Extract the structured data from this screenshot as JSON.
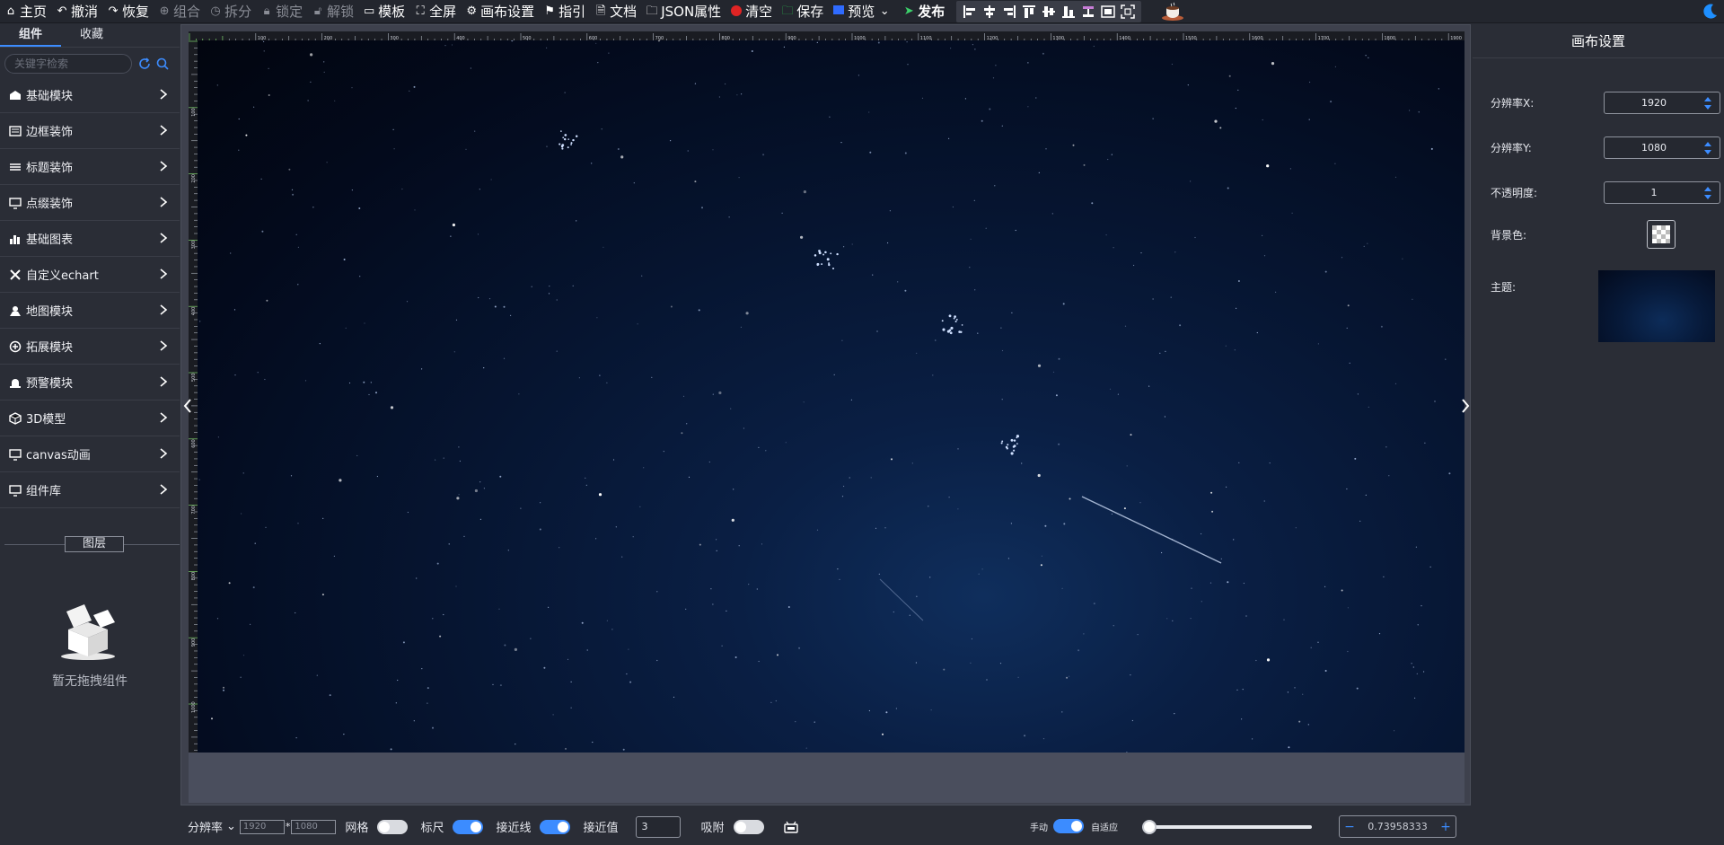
{
  "toolbar": {
    "items": [
      {
        "label": "主页",
        "icon": "home-icon",
        "dim": false
      },
      {
        "label": "撤消",
        "icon": "undo-icon",
        "dim": false
      },
      {
        "label": "恢复",
        "icon": "redo-icon",
        "dim": false
      },
      {
        "label": "组合",
        "icon": "group-icon",
        "dim": true
      },
      {
        "label": "拆分",
        "icon": "split-icon",
        "dim": true
      },
      {
        "label": "锁定",
        "icon": "lock-icon",
        "dim": true
      },
      {
        "label": "解锁",
        "icon": "unlock-icon",
        "dim": true
      },
      {
        "label": "模板",
        "icon": "template-icon",
        "dim": false
      },
      {
        "label": "全屏",
        "icon": "fullscreen-icon",
        "dim": false
      },
      {
        "label": "画布设置",
        "icon": "gear-icon",
        "dim": false
      },
      {
        "label": "指引",
        "icon": "flag-icon",
        "dim": false
      },
      {
        "label": "文档",
        "icon": "document-icon",
        "dim": false
      },
      {
        "label": "JSON属性",
        "icon": "folder-icon",
        "dim": false
      },
      {
        "label": "清空",
        "icon": "clear-icon",
        "dim": false
      },
      {
        "label": "保存",
        "icon": "save-icon",
        "dim": false
      },
      {
        "label": "预览",
        "icon": "preview-icon",
        "dim": false
      },
      {
        "label": "发布",
        "icon": "publish-icon",
        "dim": false
      }
    ],
    "colors": {
      "clear": "#e02424",
      "save": "#2bb24c",
      "preview": "#2f6bff",
      "publish": "#3cd16b"
    }
  },
  "sidebar": {
    "tabs": [
      "组件",
      "收藏"
    ],
    "search_placeholder": "关键字检索",
    "items": [
      {
        "label": "基础模块",
        "icon": "building-icon"
      },
      {
        "label": "边框装饰",
        "icon": "border-icon"
      },
      {
        "label": "标题装饰",
        "icon": "title-icon"
      },
      {
        "label": "点缀装饰",
        "icon": "decoration-icon"
      },
      {
        "label": "基础图表",
        "icon": "bar-chart-icon"
      },
      {
        "label": "自定义echart",
        "icon": "tools-icon"
      },
      {
        "label": "地图模块",
        "icon": "map-icon"
      },
      {
        "label": "拓展模块",
        "icon": "extend-icon"
      },
      {
        "label": "预警模块",
        "icon": "alarm-icon"
      },
      {
        "label": "3D模型",
        "icon": "cube-icon"
      },
      {
        "label": "canvas动画",
        "icon": "monitor-icon"
      },
      {
        "label": "组件库",
        "icon": "library-icon"
      }
    ],
    "layer_title": "图层",
    "empty_text": "暂无拖拽组件"
  },
  "ruler": {
    "h_labels": [
      "100",
      "200",
      "300",
      "400",
      "500",
      "600",
      "700",
      "800",
      "900",
      "1000",
      "1100",
      "1200",
      "1300",
      "1400",
      "1500",
      "1600",
      "1700",
      "1800",
      "1900"
    ],
    "v_labels": [
      "100",
      "200",
      "300",
      "400",
      "500",
      "600",
      "700",
      "800",
      "900",
      "1000"
    ]
  },
  "right_panel": {
    "title": "画布设置",
    "res_x_label": "分辨率X:",
    "res_x_value": "1920",
    "res_y_label": "分辨率Y:",
    "res_y_value": "1080",
    "opacity_label": "不透明度:",
    "opacity_value": "1",
    "bg_label": "背景色:",
    "theme_label": "主题:"
  },
  "bottom": {
    "res_label": "分辨率",
    "res_w_placeholder": "1920",
    "res_sep": "*",
    "res_h_placeholder": "1080",
    "grid_label": "网格",
    "grid_on": false,
    "ruler_label": "标尺",
    "ruler_on": true,
    "guide_label": "接近线",
    "guide_on": true,
    "snap_value_label": "接近值",
    "snap_value": "3",
    "adsorb_label": "吸附",
    "adsorb_on": false,
    "manual_label": "手动",
    "manual_on": true,
    "auto_label": "自适应",
    "zoom_minus": "−",
    "zoom_value": "0.73958333",
    "zoom_plus": "+"
  },
  "colors": {
    "accent": "#3c8cff",
    "panel": "#2a2d36",
    "canvas_bg": "#061531"
  }
}
